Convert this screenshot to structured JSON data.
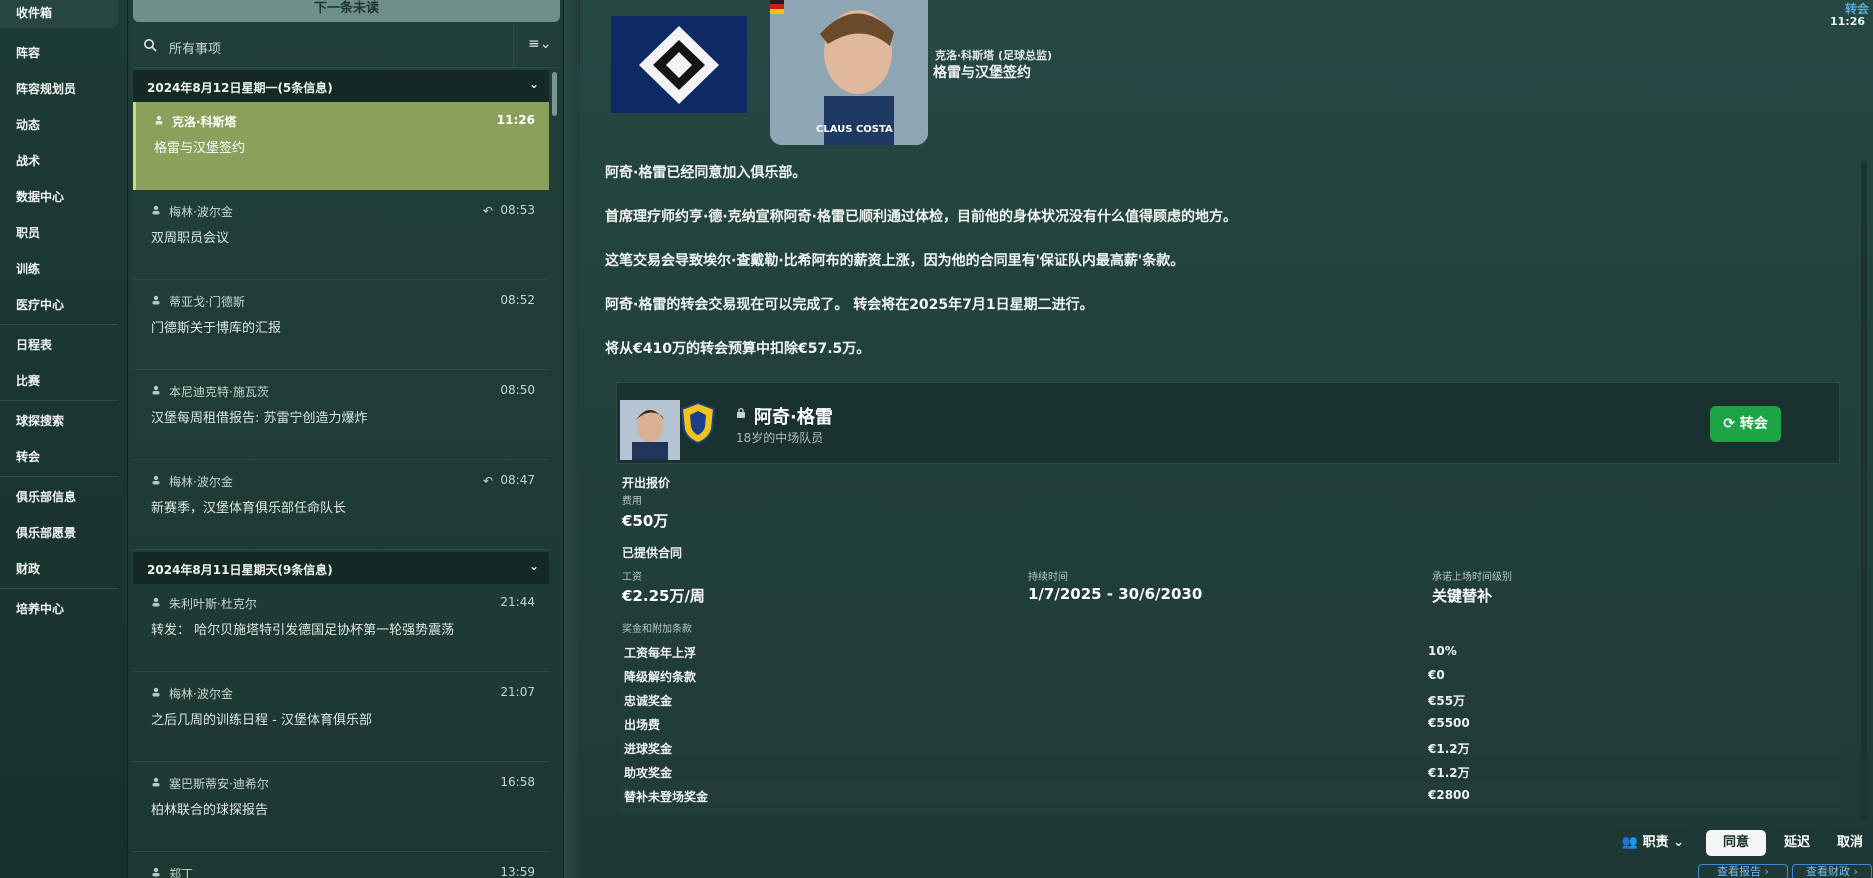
{
  "nav": {
    "items": [
      "收件箱",
      "阵容",
      "阵容规划员",
      "动态",
      "战术",
      "数据中心",
      "职员",
      "训练",
      "医疗中心",
      "日程表",
      "比赛",
      "球探搜索",
      "转会",
      "俱乐部信息",
      "俱乐部愿景",
      "财政",
      "培养中心"
    ]
  },
  "list": {
    "next_unread": "下一条未读",
    "search_placeholder": "所有事项",
    "filter_icon": "≡⌄",
    "groups": [
      {
        "header": "2024年8月12日星期一(5条信息)",
        "messages": [
          {
            "sender": "克洛·科斯塔",
            "time": "11:26",
            "subject": "格雷与汉堡签约",
            "selected": true
          },
          {
            "sender": "梅林·波尔金",
            "time": "08:53",
            "subject": "双周职员会议",
            "replied": true
          },
          {
            "sender": "蒂亚戈·门德斯",
            "time": "08:52",
            "subject": "门德斯关于博库的汇报"
          },
          {
            "sender": "本尼迪克特·施瓦茨",
            "time": "08:50",
            "subject": "汉堡每周租借报告: 苏雷宁创造力爆炸"
          },
          {
            "sender": "梅林·波尔金",
            "time": "08:47",
            "subject": "新赛季，汉堡体育俱乐部任命队长",
            "replied": true
          }
        ]
      },
      {
        "header": "2024年8月11日星期天(9条信息)",
        "messages": [
          {
            "sender": "朱利叶斯·杜克尔",
            "time": "21:44",
            "subject": "转发： 哈尔贝施塔特引发德国足协杯第一轮强势震荡"
          },
          {
            "sender": "梅林·波尔金",
            "time": "21:07",
            "subject": "之后几周的训练日程 - 汉堡体育俱乐部"
          },
          {
            "sender": "塞巴斯蒂安·迪希尔",
            "time": "16:58",
            "subject": "柏林联合的球探报告"
          },
          {
            "sender": "郑丁",
            "time": "13:59",
            "subject": ""
          }
        ]
      }
    ]
  },
  "detail": {
    "corner_tag": "转会",
    "corner_time": "11:26",
    "player_card_caption": "CLAUS COSTA",
    "sender": "克洛·科斯塔 (足球总监)",
    "subject": "格雷与汉堡签约",
    "paragraphs": [
      "阿奇·格雷已经同意加入俱乐部。",
      "首席理疗师约亨·德·克纳宣称阿奇·格雷已顺利通过体检，目前他的身体状况没有什么值得顾虑的地方。",
      "这笔交易会导致埃尔·查戴勒·比希阿布的薪资上涨，因为他的合同里有'保证队内最高薪'条款。",
      "阿奇·格雷的转会交易现在可以完成了。 转会将在2025年7月1日星期二进行。",
      "将从€410万的转会预算中扣除€57.5万。"
    ],
    "player": {
      "name": "阿奇·格雷",
      "desc": "18岁的中场队员",
      "transfer_btn": "转会"
    },
    "offer": {
      "title": "开出报价",
      "fee_label": "费用",
      "fee_value": "€50万",
      "contract_title": "已提供合同",
      "wage_label": "工资",
      "wage_value": "€2.25万/周",
      "duration_label": "持续时间",
      "duration_value": "1/7/2025 - 30/6/2030",
      "role_label": "承诺上场时间级别",
      "role_value": "关键替补",
      "bonus_title": "奖金和附加条款",
      "bonuses": [
        {
          "name": "工资每年上浮",
          "value": "10%"
        },
        {
          "name": "降级解约条款",
          "value": "€0"
        },
        {
          "name": "忠诚奖金",
          "value": "€55万"
        },
        {
          "name": "出场费",
          "value": "€5500"
        },
        {
          "name": "进球奖金",
          "value": "€1.2万"
        },
        {
          "name": "助攻奖金",
          "value": "€1.2万"
        },
        {
          "name": "替补未登场奖金",
          "value": "€2800"
        }
      ]
    },
    "actions": {
      "duty": "职责",
      "agree": "同意",
      "delay": "延迟",
      "cancel": "取消",
      "view_report": "查看报告",
      "view_finance": "查看财政"
    }
  },
  "colors": {
    "selected_message": "#8aa05b",
    "transfer_button": "#1ea447",
    "background": "#1f3a36"
  }
}
